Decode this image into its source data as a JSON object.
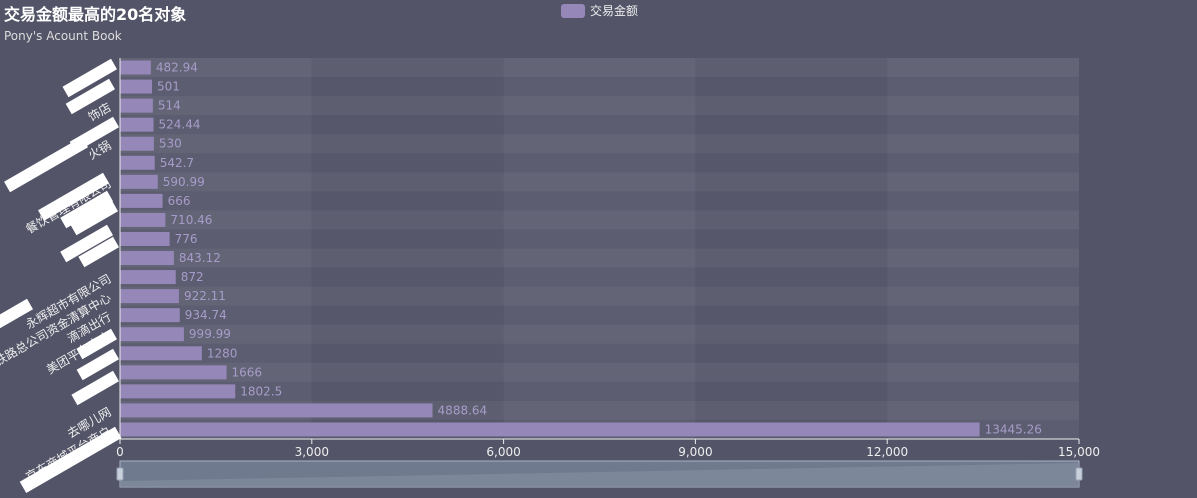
{
  "chart_data": {
    "type": "bar",
    "orientation": "horizontal",
    "title": "交易金额最高的20名对象",
    "subtitle": "Pony's Acount Book",
    "legend": [
      "交易金额"
    ],
    "legend_position": "top-center",
    "series": [
      {
        "name": "交易金额",
        "color": "#9587b8",
        "values": [
          13445.26,
          4888.64,
          1802.5,
          1666,
          1280,
          999.99,
          934.74,
          922.11,
          872,
          843.12,
          776,
          710.46,
          666,
          590.99,
          542.7,
          530,
          524.44,
          514,
          501,
          482.94
        ]
      }
    ],
    "categories": [
      "京东商城平台商户",
      "去哪儿网",
      "",
      "",
      "",
      "美团平台商户",
      "滴滴出行",
      "铁路总公司资金清算中心",
      "永辉超市有限公司",
      "",
      "",
      "",
      "",
      "餐饮管理有限公司",
      "",
      "火锅",
      "",
      "饰店",
      "",
      ""
    ],
    "xlim": [
      0,
      15000
    ],
    "xticks": [
      "0",
      "3,000",
      "6,000",
      "9,000",
      "12,000",
      "15,000"
    ],
    "grid": true,
    "datazoom": true
  }
}
